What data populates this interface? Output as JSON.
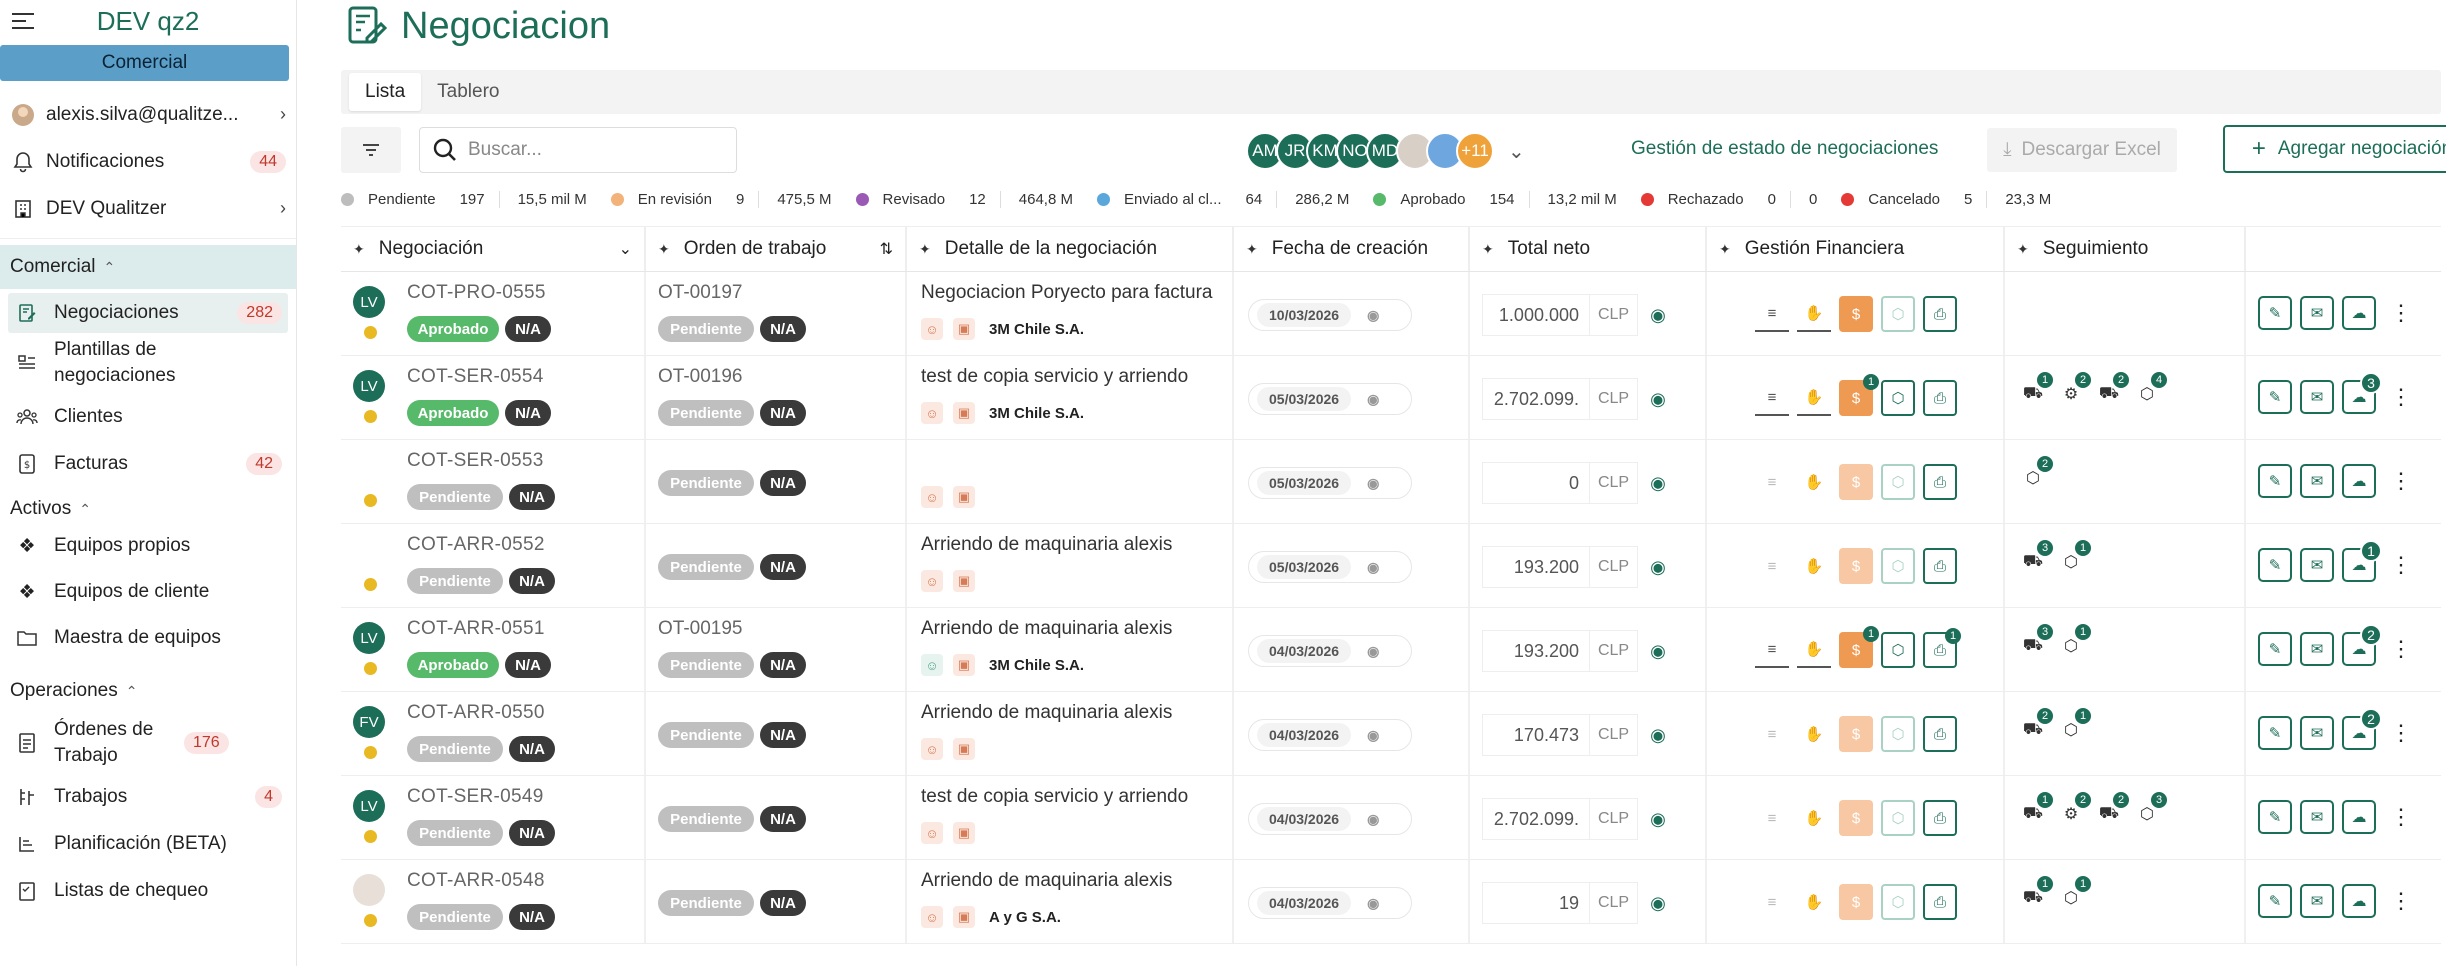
{
  "sidebar": {
    "app_name": "DEV qz2",
    "context_button": "Comercial",
    "user": "alexis.silva@qualitze...",
    "notifications": {
      "label": "Notificaciones",
      "count": "44"
    },
    "company": "DEV Qualitzer",
    "sections": [
      {
        "title": "Comercial",
        "items": [
          {
            "label": "Negociaciones",
            "count": "282",
            "icon": "negotiation-icon"
          },
          {
            "label": "Plantillas de negociaciones",
            "count": "",
            "icon": "template-icon"
          },
          {
            "label": "Clientes",
            "count": "",
            "icon": "clients-icon"
          },
          {
            "label": "Facturas",
            "count": "42",
            "icon": "invoice-icon"
          }
        ]
      },
      {
        "title": "Activos",
        "items": [
          {
            "label": "Equipos propios",
            "icon": "equipment-icon"
          },
          {
            "label": "Equipos de cliente",
            "icon": "equipment-icon"
          },
          {
            "label": "Maestra de equipos",
            "icon": "folder-icon"
          }
        ]
      },
      {
        "title": "Operaciones",
        "items": [
          {
            "label": "Órdenes de Trabajo",
            "count": "176",
            "icon": "work-order-icon"
          },
          {
            "label": "Trabajos",
            "count": "4",
            "icon": "jobs-icon"
          },
          {
            "label": "Planificación (BETA)",
            "icon": "planning-icon"
          },
          {
            "label": "Listas de chequeo",
            "icon": "checklist-icon"
          }
        ]
      }
    ]
  },
  "page": {
    "title": "Negociacion",
    "tabs": [
      "Lista",
      "Tablero"
    ],
    "search_placeholder": "Buscar...",
    "avatars": [
      "AM",
      "JR",
      "KM",
      "NO",
      "MD",
      "",
      "",
      "+11"
    ],
    "gestion_link": "Gestión de estado de negociaciones",
    "excel_button": "Descargar Excel",
    "add_button": "Agregar negociación"
  },
  "statuses": [
    {
      "name": "Pendiente",
      "count": "197",
      "amount": "15,5 mil M",
      "color": "#bdbdbd"
    },
    {
      "name": "En revisión",
      "count": "9",
      "amount": "475,5 M",
      "color": "#f2b27a"
    },
    {
      "name": "Revisado",
      "count": "12",
      "amount": "464,8 M",
      "color": "#9b59b6"
    },
    {
      "name": "Enviado al cl...",
      "count": "64",
      "amount": "286,2 M",
      "color": "#5aa7dc"
    },
    {
      "name": "Aprobado",
      "count": "154",
      "amount": "13,2 mil M",
      "color": "#57b96a"
    },
    {
      "name": "Rechazado",
      "count": "0",
      "amount": "0",
      "color": "#e53935"
    },
    {
      "name": "Cancelado",
      "count": "5",
      "amount": "23,3 M",
      "color": "#e53935"
    }
  ],
  "columns": [
    "Negociación",
    "Orden de trabajo",
    "Detalle de la negociación",
    "Fecha de creación",
    "Total neto",
    "Gestión Financiera",
    "Seguimiento",
    ""
  ],
  "rows": [
    {
      "avatar": "LV",
      "code": "COT-PRO-0555",
      "status": "Aprobado",
      "na": "N/A",
      "ot": "OT-00197",
      "ot_status": "Pendiente",
      "detail": "Negociacion Poryecto para factura",
      "client": "3M Chile S.A.",
      "date": "10/03/2026",
      "total": "1.000.000",
      "currency": "CLP",
      "fin": [
        1,
        0,
        1,
        0,
        1
      ],
      "seg": [],
      "cloud": ""
    },
    {
      "avatar": "LV",
      "code": "COT-SER-0554",
      "status": "Aprobado",
      "na": "N/A",
      "ot": "OT-00196",
      "ot_status": "Pendiente",
      "detail": "test de copia servicio y arriendo",
      "client": "3M Chile S.A.",
      "date": "05/03/2026",
      "total": "2.702.099.",
      "currency": "CLP",
      "fin": [
        0,
        0,
        1,
        1,
        1
      ],
      "fin_badge": "1",
      "seg": [
        "1",
        "2",
        "2",
        "4"
      ],
      "cloud": "3"
    },
    {
      "avatar": "",
      "code": "COT-SER-0553",
      "status": "Pendiente",
      "na": "N/A",
      "ot": "",
      "ot_status": "Pendiente",
      "detail": "",
      "client": "",
      "date": "05/03/2026",
      "total": "0",
      "currency": "CLP",
      "seg": [
        "2"
      ],
      "cloud": ""
    },
    {
      "avatar": "",
      "code": "COT-ARR-0552",
      "status": "Pendiente",
      "na": "N/A",
      "ot": "",
      "ot_status": "Pendiente",
      "detail": "Arriendo de maquinaria alexis",
      "client": "",
      "date": "05/03/2026",
      "total": "193.200",
      "currency": "CLP",
      "seg": [
        "3",
        "1"
      ],
      "cloud": "1"
    },
    {
      "avatar": "LV",
      "code": "COT-ARR-0551",
      "status": "Aprobado",
      "na": "N/A",
      "ot": "OT-00195",
      "ot_status": "Pendiente",
      "detail": "Arriendo de maquinaria alexis",
      "client": "3M Chile S.A.",
      "date": "04/03/2026",
      "total": "193.200",
      "currency": "CLP",
      "fin_badge": "1",
      "fin_badge2": "1",
      "seg": [
        "3",
        "1"
      ],
      "cloud": "2"
    },
    {
      "avatar": "FV",
      "code": "COT-ARR-0550",
      "status": "Pendiente",
      "na": "N/A",
      "ot": "",
      "ot_status": "Pendiente",
      "detail": "Arriendo de maquinaria alexis",
      "client": "",
      "date": "04/03/2026",
      "total": "170.473",
      "currency": "CLP",
      "seg": [
        "2",
        "1"
      ],
      "cloud": "2"
    },
    {
      "avatar": "LV",
      "code": "COT-SER-0549",
      "status": "Pendiente",
      "na": "N/A",
      "ot": "",
      "ot_status": "Pendiente",
      "detail": "test de copia servicio y arriendo",
      "client": "",
      "date": "04/03/2026",
      "total": "2.702.099.",
      "currency": "CLP",
      "seg": [
        "1",
        "2",
        "2",
        "3"
      ],
      "cloud": ""
    },
    {
      "avatar": "",
      "code": "COT-ARR-0548",
      "status": "Pendiente",
      "na": "N/A",
      "ot": "",
      "ot_status": "Pendiente",
      "detail": "Arriendo de maquinaria alexis",
      "client": "A y G S.A.",
      "date": "04/03/2026",
      "total": "19",
      "currency": "CLP",
      "seg": [
        "1",
        "1"
      ],
      "cloud": ""
    }
  ]
}
